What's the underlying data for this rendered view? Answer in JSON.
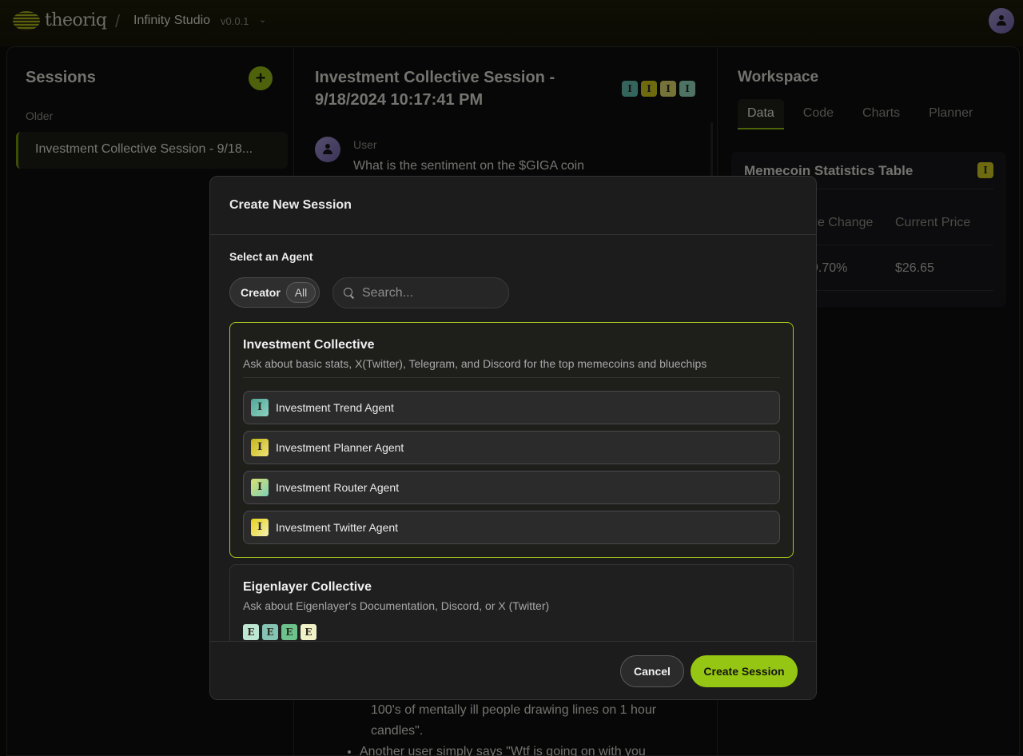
{
  "header": {
    "logo_text": "theoriq",
    "separator": "/",
    "studio_name": "Infinity Studio",
    "version": "v0.0.1"
  },
  "sessions": {
    "title": "Sessions",
    "add_label": "+",
    "group_label": "Older",
    "items": [
      {
        "label": "Investment Collective Session - 9/18..."
      }
    ]
  },
  "chat": {
    "title": "Investment Collective Session - 9/18/2024 10:17:41 PM",
    "agent_icons": [
      {
        "letter": "I",
        "color": "#5fb8a8"
      },
      {
        "letter": "I",
        "color": "#c9c21e"
      },
      {
        "letter": "I",
        "color": "#d6cf6a"
      },
      {
        "letter": "I",
        "color": "#8fd0b4"
      }
    ],
    "user_label": "User",
    "user_message": "What is the sentiment on the $GIGA coin",
    "bullet_1_partial": "100's of mentally ill people drawing lines on 1 hour candles\".",
    "bullet_2_partial": "Another user simply says \"Wtf is going on with you"
  },
  "workspace": {
    "title": "Workspace",
    "tabs": [
      {
        "label": "Data",
        "active": true
      },
      {
        "label": "Code"
      },
      {
        "label": "Charts"
      },
      {
        "label": "Planner"
      }
    ],
    "card_title": "Memecoin Statistics Table",
    "card_icon": "I",
    "columns": [
      "ce Change",
      "Current Price"
    ],
    "row": [
      "9.70%",
      "$26.65"
    ]
  },
  "modal": {
    "title": "Create New Session",
    "select_label": "Select an Agent",
    "filter_creator": "Creator",
    "filter_all": "All",
    "search_placeholder": "Search...",
    "collectives": [
      {
        "title": "Investment Collective",
        "description": "Ask about basic stats, X(Twitter), Telegram, and Discord for the top memecoins and bluechips",
        "selected": true,
        "agents": [
          {
            "label": "Investment Trend Agent",
            "icon": "I",
            "color": "#5fb8a8"
          },
          {
            "label": "Investment Planner Agent",
            "icon": "I",
            "color": "#d4c81c"
          },
          {
            "label": "Investment Router Agent",
            "icon": "I",
            "color": "#9fd6a8"
          },
          {
            "label": "Investment Twitter Agent",
            "icon": "I",
            "color": "#e8e080"
          }
        ]
      },
      {
        "title": "Eigenlayer Collective",
        "description": "Ask about Eigenlayer's Documentation, Discord, or X (Twitter)",
        "selected": false,
        "agent_icons": [
          {
            "letter": "E",
            "color": "#bfe6d2"
          },
          {
            "letter": "E",
            "color": "#86c3b2"
          },
          {
            "letter": "E",
            "color": "#6cc28a"
          },
          {
            "letter": "E",
            "color": "#f2f2c8"
          }
        ]
      }
    ],
    "cancel_label": "Cancel",
    "create_label": "Create Session"
  }
}
